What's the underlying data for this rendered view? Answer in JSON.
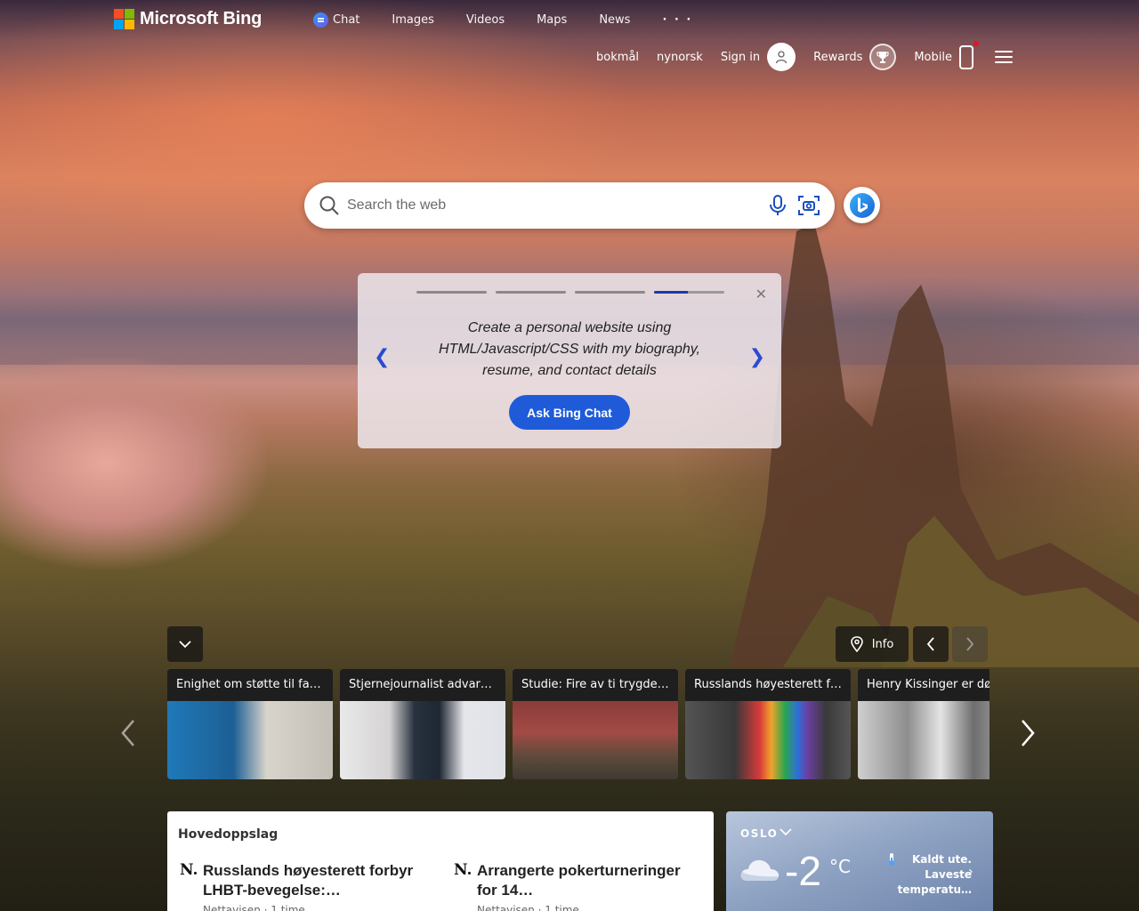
{
  "brand": {
    "name": "Microsoft Bing"
  },
  "nav": {
    "items": [
      {
        "label": "Chat",
        "icon": "bing-chat-icon"
      },
      {
        "label": "Images"
      },
      {
        "label": "Videos"
      },
      {
        "label": "Maps"
      },
      {
        "label": "News"
      }
    ],
    "more": "· · ·"
  },
  "header_right": {
    "lang1": "bokmål",
    "lang2": "nynorsk",
    "sign_in": "Sign in",
    "rewards": "Rewards",
    "mobile": "Mobile"
  },
  "search": {
    "placeholder": "Search the web"
  },
  "promo": {
    "text": "Create a personal website using HTML/Javascript/CSS with my biography, resume, and contact details",
    "button": "Ask Bing Chat",
    "slides": 4,
    "active_slide": 4
  },
  "image_controls": {
    "info": "Info"
  },
  "news_cards": [
    {
      "title": "Enighet om støtte til fa…"
    },
    {
      "title": "Stjernejournalist advar…"
    },
    {
      "title": "Studie: Fire av ti trygde…"
    },
    {
      "title": "Russlands høyesterett f…"
    },
    {
      "title": "Henry Kissinger er død"
    }
  ],
  "headlines": {
    "title": "Hovedoppslag",
    "articles": [
      {
        "source_logo": "N.",
        "headline": "Russlands høyesterett forbyr LHBT-bevegelse:…",
        "meta": "Nettavisen · 1 time"
      },
      {
        "source_logo": "N.",
        "headline": "Arrangerte pokerturneringer for 14…",
        "meta": "Nettavisen · 1 time"
      }
    ]
  },
  "weather": {
    "city": "OSLO",
    "temperature": "-2",
    "unit": "°C",
    "alert": "Kaldt ute. Laveste temperatu…"
  }
}
